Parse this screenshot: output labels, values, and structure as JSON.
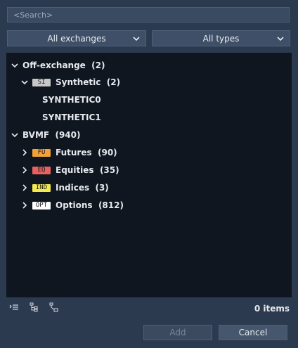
{
  "search": {
    "placeholder": "<Search>"
  },
  "filters": {
    "exchange": {
      "selected": "All exchanges"
    },
    "type": {
      "selected": "All types"
    }
  },
  "tree": {
    "nodes": [
      {
        "label": "Off-exchange",
        "count": "(2)",
        "expanded": true
      },
      {
        "badge": "SI",
        "badge_color": "#c7c7c7",
        "label": "Synthetic",
        "count": "(2)",
        "expanded": true
      },
      {
        "label": "SYNTHETIC0"
      },
      {
        "label": "SYNTHETIC1"
      },
      {
        "label": "BVMF",
        "count": "(940)",
        "expanded": true
      },
      {
        "badge": "FU",
        "badge_color": "#f0a13a",
        "label": "Futures",
        "count": "(90)",
        "expanded": false
      },
      {
        "badge": "EQ",
        "badge_color": "#e8615f",
        "label": "Equities",
        "count": "(35)",
        "expanded": false
      },
      {
        "badge": "IND",
        "badge_color": "#f3ea4f",
        "label": "Indices",
        "count": "(3)",
        "expanded": false
      },
      {
        "badge": "OPT",
        "badge_color": "#ffffff",
        "label": "Options",
        "count": "(812)",
        "expanded": false
      }
    ]
  },
  "footer": {
    "icons": [
      "list-icon",
      "tree-expand-icon",
      "tree-collapse-icon"
    ],
    "count_label": "0 items"
  },
  "buttons": {
    "add": "Add",
    "cancel": "Cancel"
  }
}
